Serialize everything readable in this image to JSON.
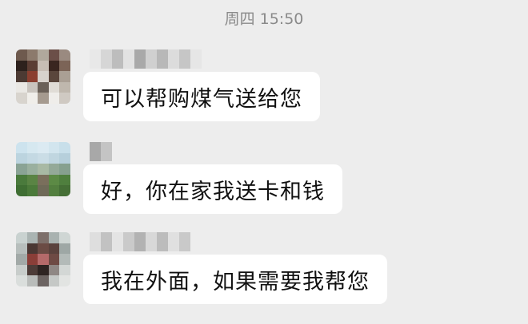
{
  "chat": {
    "timestamp": "周四 15:50",
    "messages": [
      {
        "text": "可以帮购煤气送给您"
      },
      {
        "text": "好，你在家我送卡和钱"
      },
      {
        "text": "我在外面，如果需要我帮您"
      }
    ]
  },
  "colors": {
    "background": "#ededed",
    "bubble": "#ffffff",
    "timestamp_text": "#8a8a8a",
    "message_text": "#111111"
  }
}
